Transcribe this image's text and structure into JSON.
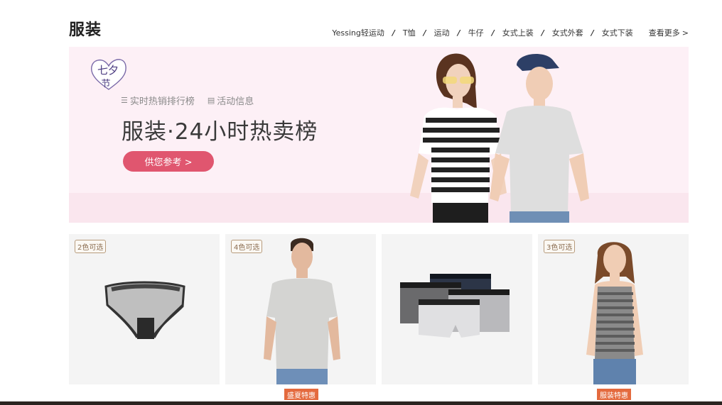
{
  "header": {
    "title": "服装",
    "nav_items": [
      "Yessing轻运动",
      "T恤",
      "运动",
      "牛仔",
      "女式上装",
      "女式外套",
      "女式下装"
    ],
    "separator": "/",
    "more_label": "查看更多",
    "more_arrow": ">"
  },
  "banner": {
    "badge_text": "七夕",
    "badge_sub": "节",
    "link_hot": "实时热销排行榜",
    "link_events": "活动信息",
    "headline": "服装·24小时热卖榜",
    "cta_label": "供您参考 >",
    "colors": {
      "background": "#fdf0f6",
      "cta": "#e0566f"
    }
  },
  "products": [
    {
      "tag": "2色可选",
      "icon": "briefs-image"
    },
    {
      "tag": "4色可选",
      "icon": "mens-tshirt-image"
    },
    {
      "tag": "",
      "icon": "boxer-briefs-image"
    },
    {
      "tag": "3色可选",
      "icon": "womens-tank-image"
    }
  ],
  "promos": [
    {
      "label": "盛夏特惠"
    },
    {
      "label": "服装特惠"
    }
  ],
  "colors": {
    "promo": "#e46a3e",
    "tag_border": "#b79b7c"
  }
}
